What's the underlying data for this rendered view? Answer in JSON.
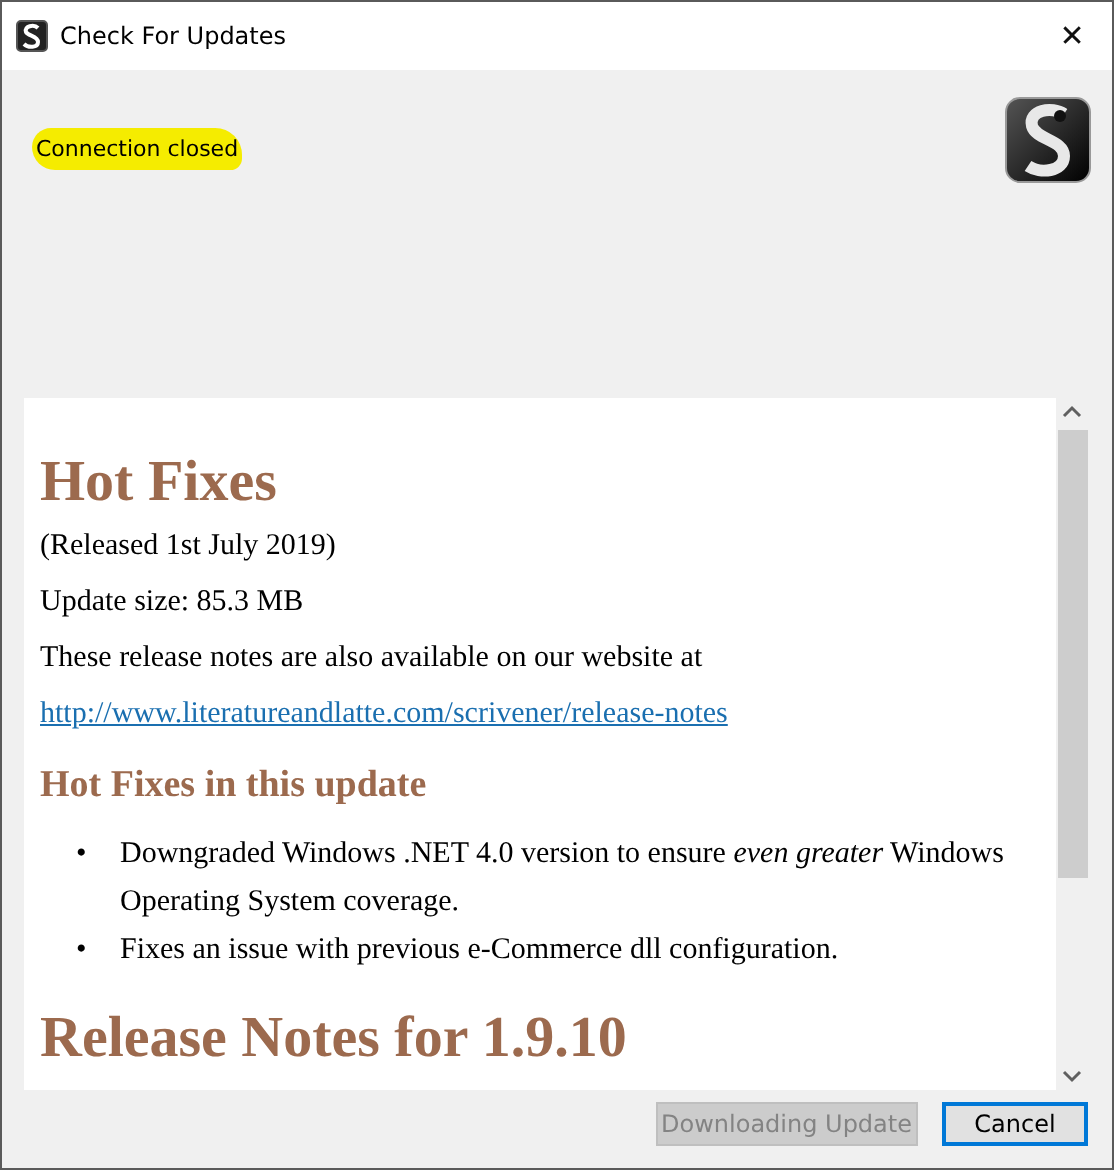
{
  "window": {
    "title": "Check For Updates",
    "close": "✕"
  },
  "status": {
    "text": "Connection closed",
    "highlighted": true
  },
  "notes": [
    {
      "kind": "heading1",
      "text": "Hot Fixes"
    },
    {
      "kind": "paragraph",
      "text": "(Released 1st July 2019)"
    },
    {
      "kind": "paragraph",
      "text": "Update size: 85.3 MB"
    },
    {
      "kind": "paragraph",
      "text": "These release notes are also available on our website at"
    },
    {
      "kind": "link",
      "text": "http://www.literatureandlatte.com/scrivener/release-notes"
    },
    {
      "kind": "heading2",
      "text": "Hot Fixes in this update"
    },
    {
      "kind": "bullets",
      "items": [
        {
          "bullet": "•",
          "text": "Downgraded Windows .NET 4.0 version to ensure *even greater* Windows Operating System coverage."
        },
        {
          "bullet": "•",
          "text": "Fixes an issue with previous e-Commerce dll configuration."
        }
      ]
    },
    {
      "kind": "heading1",
      "text": "Release Notes for 1.9.10"
    }
  ],
  "buttons": [
    {
      "label": "Downloading Update",
      "disabled": true,
      "default": false
    },
    {
      "label": "Cancel",
      "disabled": false,
      "default": true
    }
  ]
}
